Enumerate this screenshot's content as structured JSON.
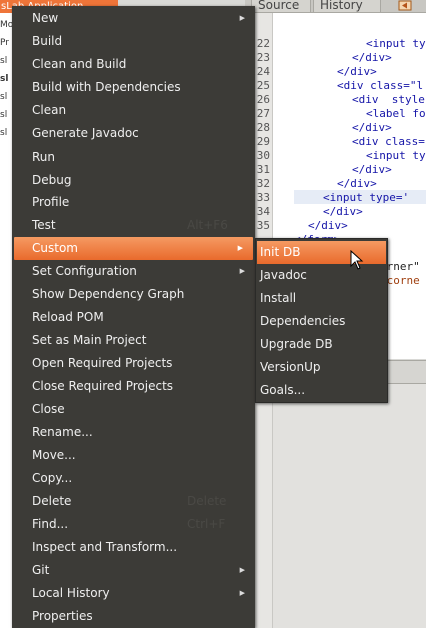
{
  "tree": {
    "selected_label": "sLab Application",
    "items": [
      {
        "label": "Mo",
        "bold": false
      },
      {
        "label": "Pr",
        "bold": false
      },
      {
        "label": "sl",
        "bold": false
      },
      {
        "label": "sl",
        "bold": true
      },
      {
        "label": "sl",
        "bold": false
      },
      {
        "label": "sl",
        "bold": false
      },
      {
        "label": "sl",
        "bold": false
      }
    ]
  },
  "editor": {
    "tabs": {
      "source": "Source",
      "history": "History"
    },
    "line_numbers": [
      "22",
      "23",
      "24",
      "25",
      "26",
      "27",
      "28",
      "29",
      "30",
      "31",
      "32",
      "33",
      "34",
      "35"
    ],
    "code_lines": [
      "<input typ",
      "</div>",
      "</div>",
      "<div class=\"l",
      "<div  style",
      "<label fo",
      "</div>",
      "<div class=",
      "<input ty",
      "</div>",
      "</div>",
      "<input type='",
      "</div>",
      "</div>",
      "</form>"
    ],
    "lower_lines": [
      "orner\"",
      "\"corne"
    ]
  },
  "context_menu": {
    "items": [
      {
        "label": "New",
        "submenu": true,
        "shortcut": ""
      },
      {
        "label": "Build",
        "submenu": false,
        "shortcut": ""
      },
      {
        "label": "Clean and Build",
        "submenu": false,
        "shortcut": ""
      },
      {
        "label": "Build with Dependencies",
        "submenu": false,
        "shortcut": ""
      },
      {
        "label": "Clean",
        "submenu": false,
        "shortcut": ""
      },
      {
        "label": "Generate Javadoc",
        "submenu": false,
        "shortcut": ""
      },
      {
        "label": "Run",
        "submenu": false,
        "shortcut": ""
      },
      {
        "label": "Debug",
        "submenu": false,
        "shortcut": ""
      },
      {
        "label": "Profile",
        "submenu": false,
        "shortcut": ""
      },
      {
        "label": "Test",
        "submenu": false,
        "shortcut": "Alt+F6"
      },
      {
        "label": "Custom",
        "submenu": true,
        "shortcut": "",
        "active": true
      },
      {
        "label": "Set Configuration",
        "submenu": true,
        "shortcut": ""
      },
      {
        "label": "Show Dependency Graph",
        "submenu": false,
        "shortcut": ""
      },
      {
        "label": "Reload POM",
        "submenu": false,
        "shortcut": ""
      },
      {
        "label": "Set as Main Project",
        "submenu": false,
        "shortcut": ""
      },
      {
        "label": "Open Required Projects",
        "submenu": false,
        "shortcut": ""
      },
      {
        "label": "Close Required Projects",
        "submenu": false,
        "shortcut": ""
      },
      {
        "label": "Close",
        "submenu": false,
        "shortcut": ""
      },
      {
        "label": "Rename...",
        "submenu": false,
        "shortcut": ""
      },
      {
        "label": "Move...",
        "submenu": false,
        "shortcut": ""
      },
      {
        "label": "Copy...",
        "submenu": false,
        "shortcut": ""
      },
      {
        "label": "Delete",
        "submenu": false,
        "shortcut": "Delete"
      },
      {
        "label": "Find...",
        "submenu": false,
        "shortcut": "Ctrl+F"
      },
      {
        "label": "Inspect and Transform...",
        "submenu": false,
        "shortcut": ""
      },
      {
        "label": "Git",
        "submenu": true,
        "shortcut": ""
      },
      {
        "label": "Local History",
        "submenu": true,
        "shortcut": ""
      },
      {
        "label": "Properties",
        "submenu": false,
        "shortcut": ""
      }
    ]
  },
  "custom_submenu": {
    "items": [
      {
        "label": "Init DB",
        "active": true
      },
      {
        "label": "Javadoc",
        "active": false
      },
      {
        "label": "Install",
        "active": false
      },
      {
        "label": "Dependencies",
        "active": false
      },
      {
        "label": "Upgrade DB",
        "active": false
      },
      {
        "label": "VersionUp",
        "active": false
      },
      {
        "label": "Goals...",
        "active": false
      }
    ]
  },
  "colors": {
    "menu_bg": "#3c3b37",
    "accent": "#ef7539",
    "menu_text": "#efefef"
  }
}
